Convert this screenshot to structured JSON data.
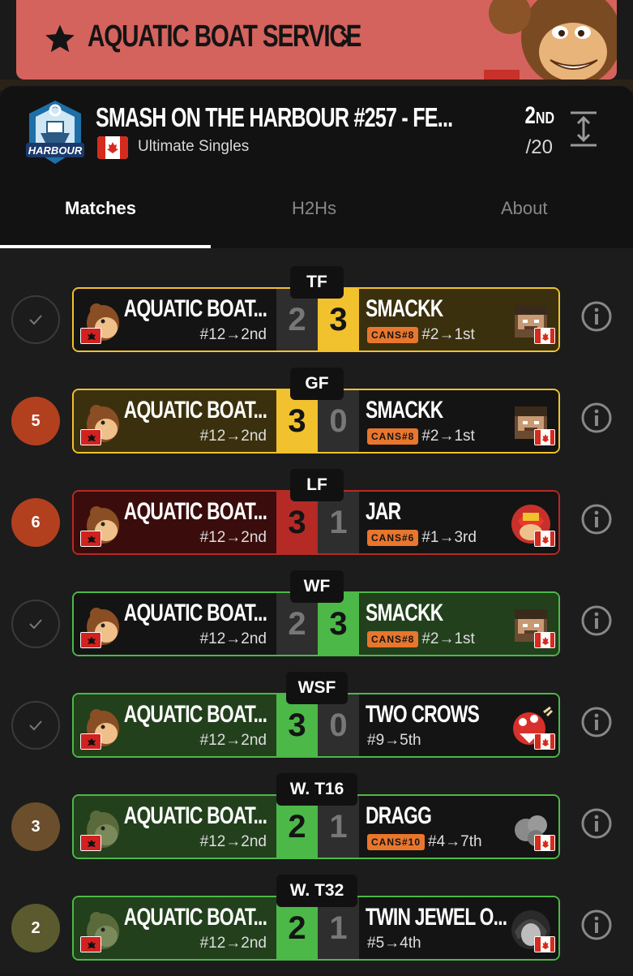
{
  "banner": {
    "label": "AQUATIC BOAT SERVICE",
    "color": "#d4635e"
  },
  "event": {
    "title": "SMASH ON THE HARBOUR #257 - FE...",
    "game": "Ultimate Singles",
    "placement": "2",
    "placement_suffix": "ND",
    "entrants": "/20",
    "logo_text": "HARBOUR"
  },
  "tabs": [
    "Matches",
    "H2Hs",
    "About"
  ],
  "player": {
    "name": "AQUATIC BOAT...",
    "seed": "#12→2nd"
  },
  "colors": {
    "win_green": "#4cb848",
    "loss_red": "#b52a24",
    "gold": "#f2c12e",
    "badge_orange": "#e8762d"
  },
  "matches": [
    {
      "round": "TF",
      "status": "check",
      "status_text": "",
      "left_score": "2",
      "right_score": "3",
      "opponent": "SMACKK",
      "badge": "CANS#8",
      "opp_seed": "#2→1st",
      "winner": "right",
      "style": "gold-right"
    },
    {
      "round": "GF",
      "status": "num",
      "status_text": "5",
      "status_color": "#b2401f",
      "left_score": "3",
      "right_score": "0",
      "opponent": "SMACKK",
      "badge": "CANS#8",
      "opp_seed": "#2→1st",
      "winner": "left",
      "style": "gold-left"
    },
    {
      "round": "LF",
      "status": "num",
      "status_text": "6",
      "status_color": "#b2401f",
      "left_score": "3",
      "right_score": "1",
      "opponent": "JAR",
      "badge": "CANS#6",
      "opp_seed": "#1→3rd",
      "winner": "left",
      "style": "red-left"
    },
    {
      "round": "WF",
      "status": "check",
      "status_text": "",
      "left_score": "2",
      "right_score": "3",
      "opponent": "SMACKK",
      "badge": "CANS#8",
      "opp_seed": "#2→1st",
      "winner": "right",
      "style": "green-right"
    },
    {
      "round": "WSF",
      "status": "check",
      "status_text": "",
      "left_score": "3",
      "right_score": "0",
      "opponent": "TWO CROWS",
      "badge": "",
      "opp_seed": "#9→5th",
      "winner": "left",
      "style": "green-left"
    },
    {
      "round": "W. T16",
      "status": "num",
      "status_text": "3",
      "status_color": "#6b4e2c",
      "left_score": "2",
      "right_score": "1",
      "opponent": "DRAGG",
      "badge": "CANS#10",
      "opp_seed": "#4→7th",
      "winner": "left",
      "style": "green-left"
    },
    {
      "round": "W. T32",
      "status": "num",
      "status_text": "2",
      "status_color": "#5a5a2e",
      "left_score": "2",
      "right_score": "1",
      "opponent": "TWIN JEWEL O...",
      "badge": "",
      "opp_seed": "#5→4th",
      "winner": "left",
      "style": "green-left"
    }
  ]
}
